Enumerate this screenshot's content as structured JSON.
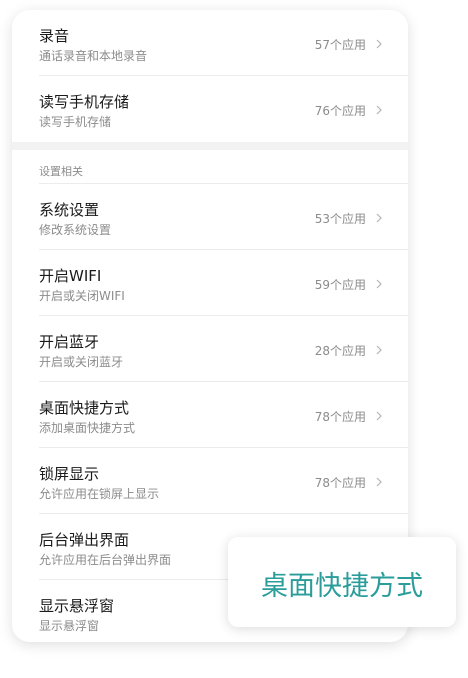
{
  "permissions_top": [
    {
      "title": "录音",
      "subtitle": "通话录音和本地录音",
      "count": "57个应用"
    },
    {
      "title": "读写手机存储",
      "subtitle": "读写手机存储",
      "count": "76个应用"
    }
  ],
  "section_header": "设置相关",
  "permissions_settings": [
    {
      "title": "系统设置",
      "subtitle": "修改系统设置",
      "count": "53个应用"
    },
    {
      "title": "开启WIFI",
      "subtitle": "开启或关闭WIFI",
      "count": "59个应用"
    },
    {
      "title": "开启蓝牙",
      "subtitle": "开启或关闭蓝牙",
      "count": "28个应用"
    },
    {
      "title": "桌面快捷方式",
      "subtitle": "添加桌面快捷方式",
      "count": "78个应用"
    },
    {
      "title": "锁屏显示",
      "subtitle": "允许应用在锁屏上显示",
      "count": "78个应用"
    },
    {
      "title": "后台弹出界面",
      "subtitle": "允许应用在后台弹出界面",
      "count": ""
    },
    {
      "title": "显示悬浮窗",
      "subtitle": "显示悬浮窗",
      "count": ""
    }
  ],
  "callout": {
    "text": "桌面快捷方式",
    "color": "#2a9d9a"
  },
  "icons": {
    "chevron": "chevron-right-icon"
  }
}
